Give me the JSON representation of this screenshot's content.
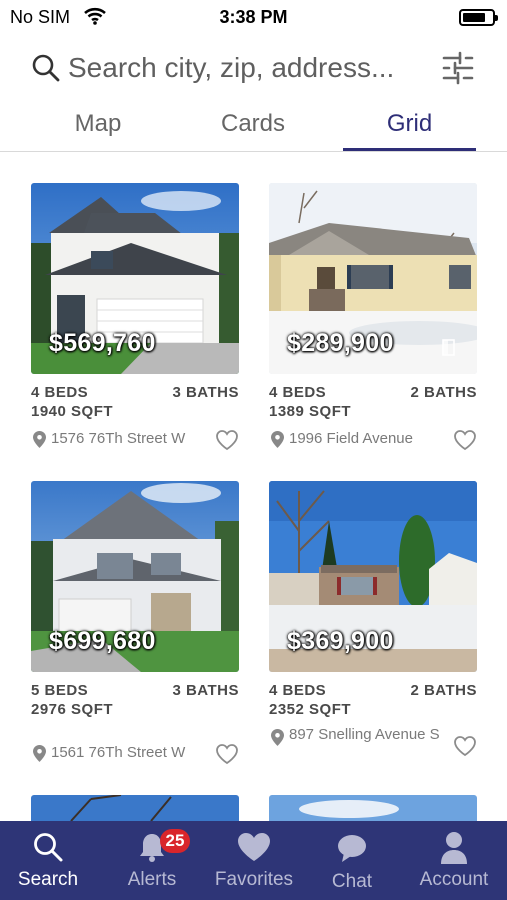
{
  "status_bar": {
    "carrier": "No SIM",
    "time": "3:38 PM",
    "battery_level": 0.8
  },
  "search": {
    "placeholder": "Search city, zip, address...",
    "icon": "search-icon",
    "filter_icon": "filter-sliders-icon"
  },
  "view_tabs": [
    {
      "label": "Map",
      "active": false
    },
    {
      "label": "Cards",
      "active": false
    },
    {
      "label": "Grid",
      "active": true
    }
  ],
  "listings": [
    {
      "price": "$569,760",
      "beds": "4 BEDS",
      "baths": "3 BATHS",
      "sqft": "1940 SQFT",
      "address": "1576 76Th Street W",
      "favorited": false
    },
    {
      "price": "$289,900",
      "beds": "4 BEDS",
      "baths": "2 BATHS",
      "sqft": "1389 SQFT",
      "address": "1996 Field Avenue",
      "favorited": false
    },
    {
      "price": "$699,680",
      "beds": "5 BEDS",
      "baths": "3 BATHS",
      "sqft": "2976 SQFT",
      "address": "1561 76Th Street W",
      "favorited": false
    },
    {
      "price": "$369,900",
      "beds": "4 BEDS",
      "baths": "2 BATHS",
      "sqft": "2352 SQFT",
      "address": "897 Snelling Avenue S",
      "favorited": false
    }
  ],
  "tab_bar": {
    "items": [
      {
        "label": "Search",
        "icon": "search-icon",
        "active": true
      },
      {
        "label": "Alerts",
        "icon": "bell-icon",
        "active": false,
        "badge": "25"
      },
      {
        "label": "Favorites",
        "icon": "heart-icon",
        "active": false
      },
      {
        "label": "Chat",
        "icon": "chat-bubble-icon",
        "active": false
      },
      {
        "label": "Account",
        "icon": "person-icon",
        "active": false
      }
    ]
  },
  "colors": {
    "brand": "#2e3577",
    "active_tab": "#2e2e77",
    "badge": "#d9252b"
  }
}
